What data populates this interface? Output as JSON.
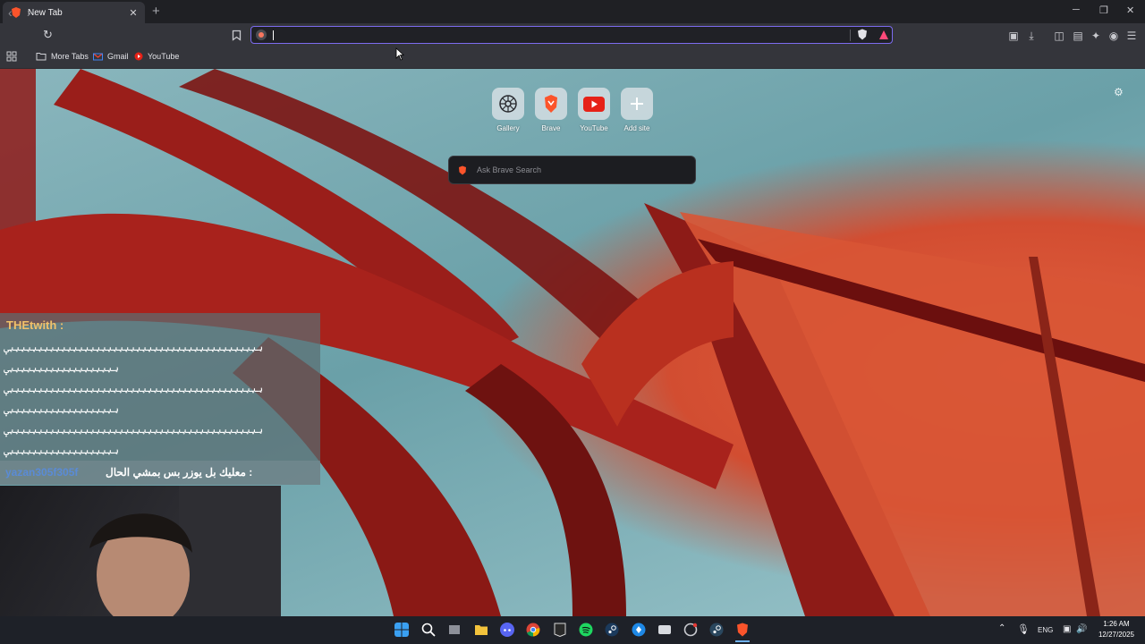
{
  "tab": {
    "title": "New Tab",
    "close": "✕"
  },
  "window": {
    "minimize": "─",
    "restore": "❐",
    "close": "✕"
  },
  "address_bar": {
    "value": ""
  },
  "bookmarks": [
    {
      "label": "More Tabs",
      "icon": "folder-icon"
    },
    {
      "label": "Gmail",
      "icon": "gmail-icon"
    },
    {
      "label": "YouTube",
      "icon": "youtube-icon"
    }
  ],
  "quick_sites": [
    {
      "label": "Gallery",
      "icon": "gallery-icon"
    },
    {
      "label": "Brave",
      "icon": "brave-icon"
    },
    {
      "label": "YouTube",
      "icon": "youtube-icon"
    },
    {
      "label": "Add site",
      "icon": "plus-icon"
    }
  ],
  "search": {
    "placeholder": "Ask Brave Search"
  },
  "chat": {
    "user1": "THEtwith :",
    "lines": [
      "ؠؠؠؠؠؠؠؠؠؠؠؠؠؠؠؠؠؠؠؠؠؠؠؠؠؠؠؠؠؠؠؠؠؠؠؠؠؠؠؠؠؠؠؠؠ",
      "ؠؠؠؠؠؠؠؠؠؠؠؠؠؠؠؠؠؠؠؠ",
      "ؠؠؠؠؠؠؠؠؠؠؠؠؠؠؠؠؠؠؠؠؠؠؠؠؠؠؠؠؠؠؠؠؠؠؠؠؠؠؠؠؠؠؠؠؠ",
      "ؠؠؠؠؠؠؠؠؠؠؠؠؠؠؠؠؠؠؠؠ",
      "ؠؠؠؠؠؠؠؠؠؠؠؠؠؠؠؠؠؠؠؠؠؠؠؠؠؠؠؠؠؠؠؠؠؠؠؠؠؠؠؠؠؠؠؠؠ",
      "ؠؠؠؠؠؠؠؠؠؠؠؠؠؠؠؠؠؠؠؠ"
    ],
    "user2": "yazan305f305f",
    "message2": ": معليك بل يوزر بس بمشي الحال"
  },
  "tray": {
    "language": "ENG"
  },
  "clock": {
    "time": "1:26 AM",
    "date": "12/27/2025"
  },
  "colors": {
    "accent": "#7c6cf0",
    "brave_orange": "#fb542b",
    "youtube_red": "#e62117"
  }
}
